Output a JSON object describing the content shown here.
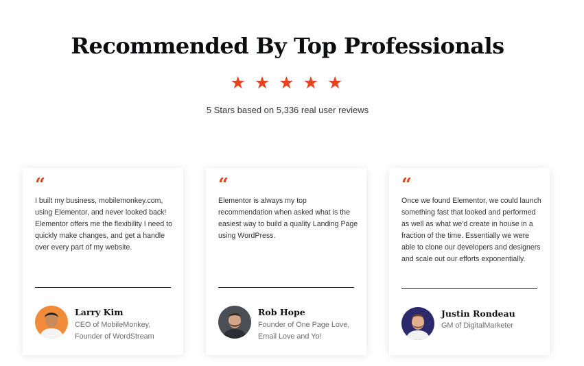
{
  "section": {
    "heading": "Recommended By Top Professionals",
    "stars": [
      "★",
      "★",
      "★",
      "★",
      "★"
    ],
    "rating_text": "5 Stars based on 5,336 real user reviews",
    "accent_color": "#e8421e"
  },
  "testimonials": [
    {
      "quote_mark": "“",
      "quote": "I built my business, mobilemonkey.com, using Elementor, and never looked back! Elementor offers me the flexibility I need to quickly make changes, and get a handle over every part of my website.",
      "name": "Larry Kim",
      "role": "CEO of MobileMonkey, Founder of WordStream",
      "avatar_icon": "person-avatar-icon"
    },
    {
      "quote_mark": "“",
      "quote": "Elementor is always my top recommendation when asked what is the easiest way to build a quality Landing Page using WordPress.",
      "name": "Rob Hope",
      "role": "Founder of One Page Love, Email Love and Yo!",
      "avatar_icon": "person-avatar-icon"
    },
    {
      "quote_mark": "“",
      "quote": "Once we found Elementor, we could launch something fast that looked and performed as well as what we'd create in house in a fraction of the time. Essentially we were able to clone our developers and designers and scale out our efforts exponentially.",
      "name": "Justin Rondeau",
      "role": "GM of DigitalMarketer",
      "avatar_icon": "person-avatar-icon"
    }
  ]
}
